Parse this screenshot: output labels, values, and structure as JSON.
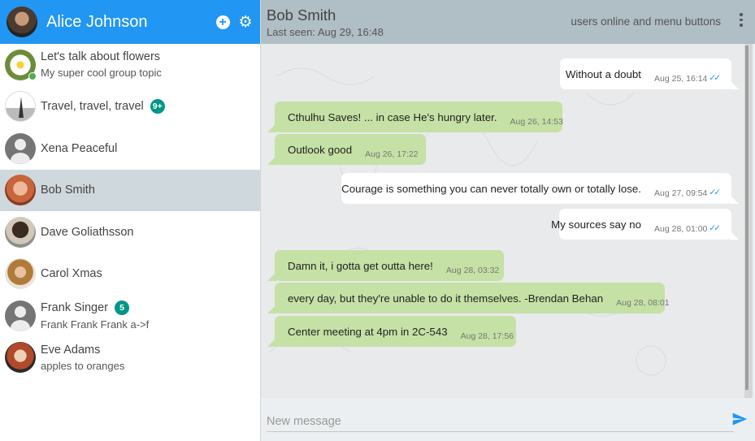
{
  "me": {
    "name": "Alice Johnson"
  },
  "contacts": [
    {
      "name": "Let's talk about flowers",
      "subtitle": "My super cool group topic",
      "badge": "",
      "avatar": "flower-avatar",
      "online": true
    },
    {
      "name": "Travel, travel, travel",
      "subtitle": "",
      "badge": "9+",
      "avatar": "eiffel-tower-avatar",
      "online": false
    },
    {
      "name": "Xena Peaceful",
      "subtitle": "",
      "badge": "",
      "avatar": "generic-person-avatar",
      "online": false
    },
    {
      "name": "Bob Smith",
      "subtitle": "",
      "badge": "",
      "avatar": "bob-smith-avatar",
      "online": false,
      "selected": true
    },
    {
      "name": "Dave Goliathsson",
      "subtitle": "",
      "badge": "",
      "avatar": "dave-avatar",
      "online": false
    },
    {
      "name": "Carol Xmas",
      "subtitle": "",
      "badge": "",
      "avatar": "carol-avatar",
      "online": false
    },
    {
      "name": "Frank Singer",
      "subtitle": "Frank Frank Frank a->f",
      "badge": "5",
      "avatar": "generic-person-avatar",
      "online": false
    },
    {
      "name": "Eve Adams",
      "subtitle": "apples to oranges",
      "badge": "",
      "avatar": "eve-avatar",
      "online": false
    }
  ],
  "chat": {
    "peer_name": "Bob Smith",
    "last_seen": "Last seen: Aug 29, 16:48",
    "header_hint": "users online and menu buttons"
  },
  "messages": [
    {
      "text": "Without a doubt",
      "time": "Aug 25, 16:14",
      "direction": "out",
      "read": true
    },
    {
      "text": "Cthulhu Saves! ... in case He's hungry later.",
      "time": "Aug 26, 14:53",
      "direction": "in"
    },
    {
      "text": "Outlook good",
      "time": "Aug 26, 17:22",
      "direction": "in"
    },
    {
      "text": "Courage is something you can never totally own or totally lose.",
      "time": "Aug 27, 09:54",
      "direction": "out",
      "read": true
    },
    {
      "text": "My sources say no",
      "time": "Aug 28, 01:00",
      "direction": "out",
      "read": true
    },
    {
      "text": "Damn it, i gotta get outta here!",
      "time": "Aug 28, 03:32",
      "direction": "in"
    },
    {
      "text": "every day, but they're unable to do it themselves. -Brendan Behan",
      "time": "Aug 28, 08:01",
      "direction": "in"
    },
    {
      "text": "Center meeting at 4pm in 2C-543",
      "time": "Aug 28, 17:56",
      "direction": "in"
    }
  ],
  "composer": {
    "placeholder": "New message",
    "value": ""
  },
  "icons": {
    "add": "plus-circle-icon",
    "settings": "gear-icon",
    "menu": "more-vertical-icon",
    "send": "send-icon",
    "read_receipt": "double-check-icon"
  },
  "colors": {
    "sidebar_header": "#2196f3",
    "chat_header": "#b0bec5",
    "selected_contact": "#cfd8dc",
    "incoming_bubble": "#c5e1a5",
    "outgoing_bubble": "#ffffff",
    "badge": "#009688",
    "online": "#4caf50"
  }
}
